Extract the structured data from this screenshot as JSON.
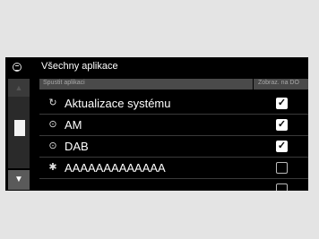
{
  "header": {
    "title": "Všechny aplikace",
    "menu_icon": "menu-icon"
  },
  "columns": {
    "left": "Spustit aplikaci",
    "right": "Zobraz. na DO"
  },
  "rows": [
    {
      "icon": "refresh-icon",
      "icon_glyph": "↻",
      "label": "Aktualizace systému",
      "checked": true
    },
    {
      "icon": "radio-icon",
      "icon_glyph": "⊙",
      "label": "AM",
      "checked": true
    },
    {
      "icon": "radio-icon",
      "icon_glyph": "⊙",
      "label": "DAB",
      "checked": true
    },
    {
      "icon": "gear-icon",
      "icon_glyph": "✱",
      "label": "AAAAAAAAAAAAA",
      "checked": false
    }
  ],
  "colors": {
    "background": "#000000",
    "accent": "#ffffff"
  }
}
